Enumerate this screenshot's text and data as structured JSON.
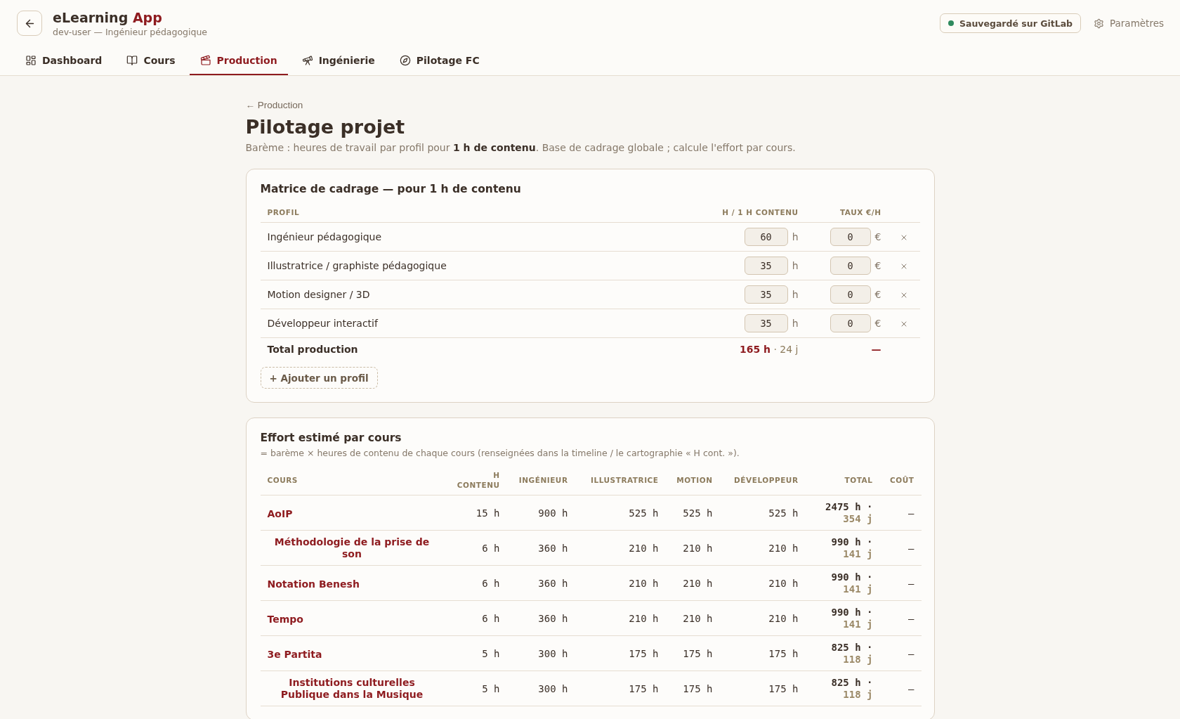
{
  "header": {
    "title": {
      "name": "eLearning",
      "accent": "App"
    },
    "user": "dev-user — Ingénieur pédagogique",
    "sync_status": {
      "label": "Sauvegardé sur GitLab",
      "synced": true
    },
    "settings": "Paramètres"
  },
  "tabs": [
    {
      "label": "Dashboard",
      "selected": false
    },
    {
      "label": "Cours",
      "selected": false
    },
    {
      "label": "Production",
      "selected": true
    },
    {
      "label": "Ingénierie",
      "selected": false
    },
    {
      "label": "Pilotage FC",
      "selected": false
    }
  ],
  "breadcrumb": "← Production",
  "page": {
    "title": "Pilotage projet",
    "description": "Barème : heures de travail par profil pour **1 h de contenu**. Base de cadrage globale ; calcule l'effort par cours."
  },
  "matrix": {
    "title": "Matrice de cadrage — pour 1 h de contenu",
    "columns": [
      "PROFIL",
      "H / 1 H CONTENU",
      "TAUX €/H"
    ],
    "rows": [
      {
        "name": "Ingénieur pédagogique",
        "hours": "60",
        "hours_unit": "h",
        "rate": "0",
        "rate_unit": "€"
      },
      {
        "name": "Illustratrice / graphiste pédagogique",
        "hours": "35",
        "hours_unit": "h",
        "rate": "0",
        "rate_unit": "€"
      },
      {
        "name": "Motion designer / 3D",
        "hours": "35",
        "hours_unit": "h",
        "rate": "0",
        "rate_unit": "€"
      },
      {
        "name": "Développeur interactif",
        "hours": "35",
        "hours_unit": "h",
        "rate": "0",
        "rate_unit": "€"
      }
    ],
    "total": {
      "label": "Total production",
      "hours": "165 h",
      "days": "· 24 j",
      "rate": "—"
    },
    "add_button": "+ Ajouter un profil"
  },
  "effort": {
    "title": "Effort estimé par cours",
    "note": "= barème × heures de contenu de chaque cours (renseignées dans la timeline / le cartographie « H cont. »).",
    "columns": [
      "COURS",
      "H CONTENU",
      "INGÉNIEUR",
      "ILLUSTRATRICE",
      "MOTION",
      "DÉVELOPPEUR",
      "TOTAL",
      "COÛT"
    ],
    "rows": [
      {
        "name": "AoIP",
        "content": "15 h",
        "by_profile": [
          "900 h",
          "525 h",
          "525 h",
          "525 h"
        ],
        "total": "2475 h ·",
        "days": "354 j",
        "cost": "—"
      },
      {
        "name": "Méthodologie de la prise de son",
        "content": "6 h",
        "by_profile": [
          "360 h",
          "210 h",
          "210 h",
          "210 h"
        ],
        "total": "990 h ·",
        "days": "141 j",
        "cost": "—"
      },
      {
        "name": "Notation Benesh",
        "content": "6 h",
        "by_profile": [
          "360 h",
          "210 h",
          "210 h",
          "210 h"
        ],
        "total": "990 h ·",
        "days": "141 j",
        "cost": "—"
      },
      {
        "name": "Tempo",
        "content": "6 h",
        "by_profile": [
          "360 h",
          "210 h",
          "210 h",
          "210 h"
        ],
        "total": "990 h ·",
        "days": "141 j",
        "cost": "—"
      },
      {
        "name": "3e Partita",
        "content": "5 h",
        "by_profile": [
          "300 h",
          "175 h",
          "175 h",
          "175 h"
        ],
        "total": "825 h ·",
        "days": "118 j",
        "cost": "—"
      },
      {
        "name": "Institutions culturelles Publique dans la Musique",
        "content": "5 h",
        "by_profile": [
          "300 h",
          "175 h",
          "175 h",
          "175 h"
        ],
        "total": "825 h ·",
        "days": "118 j",
        "cost": "—"
      }
    ]
  }
}
